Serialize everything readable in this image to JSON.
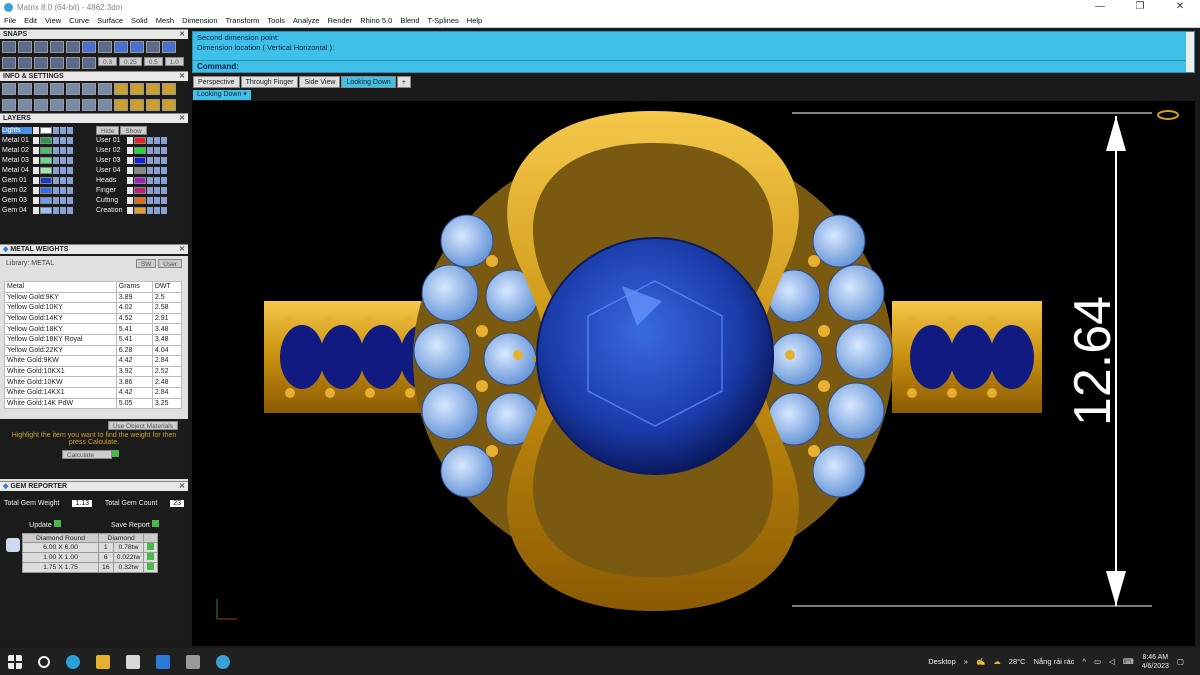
{
  "window": {
    "title": "Matrix 8.0 (64-bit) - 4862.3dm",
    "minimize": "—",
    "restore": "❐",
    "close": "✕"
  },
  "menu": [
    "File",
    "Edit",
    "View",
    "Curve",
    "Surface",
    "Solid",
    "Mesh",
    "Dimension",
    "Transform",
    "Tools",
    "Analyze",
    "Render",
    "Rhino 5.0",
    "Blend",
    "T-Splines",
    "Help"
  ],
  "snaps": {
    "title": "SNAPS",
    "values": [
      "0.3",
      "0.25",
      "0.5",
      "1.0"
    ]
  },
  "info": {
    "title": "INFO & SETTINGS"
  },
  "layers": {
    "title": "LAYERS",
    "hide": "Hide",
    "show": "Show",
    "left": [
      {
        "name": "Lights",
        "color": "#ffffff"
      },
      {
        "name": "Metal 01",
        "color": "#2a9a4a"
      },
      {
        "name": "Metal 02",
        "color": "#44c06a"
      },
      {
        "name": "Metal 03",
        "color": "#66d888"
      },
      {
        "name": "Metal 04",
        "color": "#99e8aa"
      },
      {
        "name": "Gem 01",
        "color": "#1a3ad0"
      },
      {
        "name": "Gem 02",
        "color": "#3a6ae8"
      },
      {
        "name": "Gem 03",
        "color": "#6a9af0"
      },
      {
        "name": "Gem 04",
        "color": "#9ac0f8"
      }
    ],
    "right": [
      {
        "name": "User 01",
        "color": "#e82020"
      },
      {
        "name": "User 02",
        "color": "#20d840"
      },
      {
        "name": "User 03",
        "color": "#1020e0"
      },
      {
        "name": "User 04",
        "color": "#888888"
      },
      {
        "name": "Heads",
        "color": "#9a20c0"
      },
      {
        "name": "Finger",
        "color": "#c02070"
      },
      {
        "name": "Cutting",
        "color": "#e86a10"
      },
      {
        "name": "Creation",
        "color": "#e8a020"
      }
    ]
  },
  "metal_weights": {
    "title": "METAL WEIGHTS",
    "library": "Library: METAL",
    "sw": "SW",
    "user": "User",
    "headers": [
      "Metal",
      "Grams",
      "DWT"
    ],
    "rows": [
      [
        "Yellow Gold:9KY",
        "3.89",
        "2.5"
      ],
      [
        "Yellow Gold:10KY",
        "4.02",
        "2.58"
      ],
      [
        "Yellow Gold:14KY",
        "4.52",
        "2.91"
      ],
      [
        "Yellow Gold:18KY",
        "5.41",
        "3.48"
      ],
      [
        "Yellow Gold:18KY Royal",
        "5.41",
        "3.48"
      ],
      [
        "Yellow Gold:22KY",
        "6.28",
        "4.04"
      ],
      [
        "White Gold:9KW",
        "4.42",
        "2.84"
      ],
      [
        "White Gold:10KX1",
        "3.92",
        "2.52"
      ],
      [
        "White Gold:10KW",
        "3.86",
        "2.48"
      ],
      [
        "White Gold:14KX1",
        "4.42",
        "2.84"
      ],
      [
        "White Gold:14K PdW",
        "5.05",
        "3.25"
      ]
    ],
    "use_obj": "Use Object Materials",
    "hint": "Highlight the item you want to find the weight for then press Calculate.",
    "calculate": "Calculate"
  },
  "gem_reporter": {
    "title": "GEM REPORTER",
    "total_weight_label": "Total Gem Weight",
    "total_weight": "1.13",
    "total_count_label": "Total Gem Count",
    "total_count": "23",
    "update": "Update",
    "save": "Save Report",
    "headers": [
      "Diamond Round",
      "Diamond"
    ],
    "rows": [
      [
        "6.00 X 6.00",
        "1",
        "0.78tw"
      ],
      [
        "1.00 X 1.00",
        "6",
        "0.022tw"
      ],
      [
        "1.75 X 1.75",
        "16",
        "0.32tw"
      ]
    ]
  },
  "command": {
    "line1": "Second dimension point:",
    "line2": "Dimension location ( Vertical  Horizontal ):",
    "prompt": "Command:"
  },
  "tabs": [
    "Perspective",
    "Through Finger",
    "Side View",
    "Looking Down"
  ],
  "view_label": "Looking Down",
  "dimension": {
    "value": "12.64"
  },
  "colors": {
    "gold": "#d4a017",
    "sapphire": "#1a3aa8",
    "diamond": "#8fb8f0",
    "accent": "#3fc0e8"
  },
  "taskbar": {
    "desktop": "Desktop",
    "temp": "28°C",
    "weather": "Nắng rải rác",
    "time": "8:46 AM",
    "date": "4/6/2023"
  }
}
